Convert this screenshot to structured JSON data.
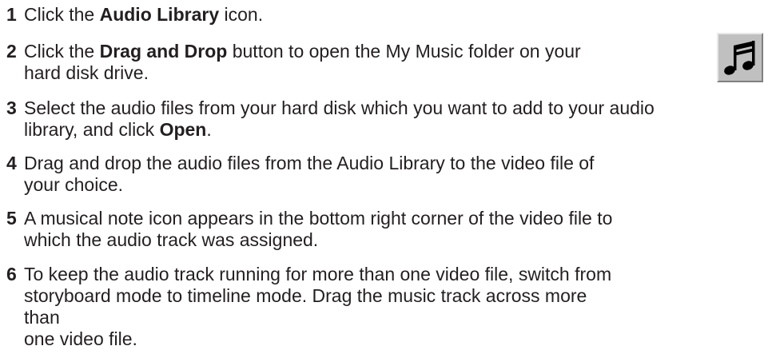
{
  "steps": [
    {
      "number": "1",
      "parts": [
        {
          "text": "Click the ",
          "bold": false
        },
        {
          "text": "Audio Library",
          "bold": true
        },
        {
          "text": " icon.",
          "bold": false
        }
      ]
    },
    {
      "number": "2",
      "parts": [
        {
          "text": "Click the ",
          "bold": false
        },
        {
          "text": "Drag and Drop",
          "bold": true
        },
        {
          "text": " button to open the My Music folder on your",
          "bold": false
        },
        {
          "break": true
        },
        {
          "text": "hard disk drive.",
          "bold": false
        }
      ]
    },
    {
      "number": "3",
      "parts": [
        {
          "text": "Select the audio files from your hard disk which you want to add to your audio",
          "bold": false
        },
        {
          "break": true
        },
        {
          "text": "library, and click ",
          "bold": false
        },
        {
          "text": "Open",
          "bold": true
        },
        {
          "text": ".",
          "bold": false
        }
      ]
    },
    {
      "number": "4",
      "parts": [
        {
          "text": "Drag and drop the audio files from the Audio Library to the video file of",
          "bold": false
        },
        {
          "break": true
        },
        {
          "text": "your choice.",
          "bold": false
        }
      ]
    },
    {
      "number": "5",
      "parts": [
        {
          "text": "A musical note icon appears in the bottom right corner of the video file to",
          "bold": false
        },
        {
          "break": true
        },
        {
          "text": "which the audio track was assigned.",
          "bold": false
        }
      ]
    },
    {
      "number": "6",
      "parts": [
        {
          "text": "To keep the audio track running for more than one video file, switch from",
          "bold": false
        },
        {
          "break": true
        },
        {
          "text": "storyboard mode to timeline mode. Drag the music track across more than",
          "bold": false
        },
        {
          "break": true
        },
        {
          "text": "one video file.",
          "bold": false
        }
      ]
    }
  ],
  "icon": {
    "name": "music-note-icon"
  }
}
